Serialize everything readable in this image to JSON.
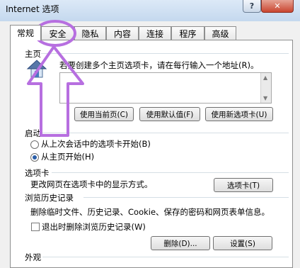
{
  "window": {
    "title": "Internet 选项",
    "help_glyph": "?",
    "close_glyph": "✕"
  },
  "tabs": [
    {
      "label": "常规",
      "active": true
    },
    {
      "label": "安全",
      "active": false
    },
    {
      "label": "隐私",
      "active": false
    },
    {
      "label": "内容",
      "active": false
    },
    {
      "label": "连接",
      "active": false
    },
    {
      "label": "程序",
      "active": false
    },
    {
      "label": "高级",
      "active": false
    }
  ],
  "home": {
    "heading": "主页",
    "description": "若要创建多个主页选项卡，请在每行输入一个地址(R)。",
    "buttons": [
      "使用当前页(C)",
      "使用默认值(F)",
      "使用新选项卡(U)"
    ]
  },
  "startup": {
    "heading": "启动",
    "options": [
      {
        "label": "从上次会话中的选项卡开始(B)",
        "checked": false
      },
      {
        "label": "从主页开始(H)",
        "checked": true
      }
    ]
  },
  "tabs_section": {
    "heading": "选项卡",
    "description": "更改网页在选项卡中的显示方式。",
    "button": "选项卡(T)"
  },
  "history": {
    "heading": "浏览历史记录",
    "description": "删除临时文件、历史记录、Cookie、保存的密码和网页表单信息。",
    "checkbox_label": "退出时删除浏览历史记录(W)",
    "delete_button": "删除(D)...",
    "settings_button": "设置(S)"
  },
  "appearance": {
    "heading": "外观"
  },
  "colors": {
    "annotation": "#b76fe0"
  }
}
